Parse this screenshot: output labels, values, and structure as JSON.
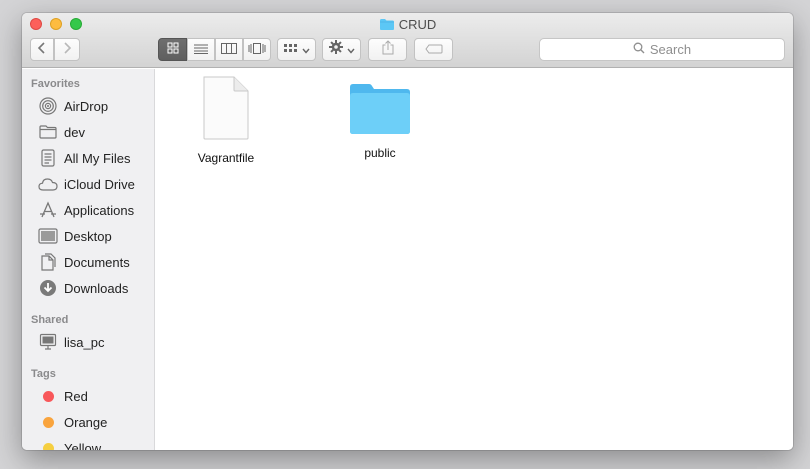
{
  "window": {
    "title": "CRUD"
  },
  "toolbar": {
    "back_icon": "chevron-left-icon",
    "forward_icon": "chevron-right-icon",
    "view_modes": [
      "icon-view",
      "list-view",
      "column-view",
      "cover-flow-view"
    ],
    "active_view": "icon-view",
    "arrange_icon": "arrange-grid-icon",
    "action_icon": "gear-icon",
    "share_icon": "share-icon",
    "tag_icon": "tag-icon",
    "search_placeholder": "Search"
  },
  "sidebar": {
    "favorites": {
      "heading": "Favorites",
      "items": [
        {
          "label": "AirDrop",
          "icon": "airdrop-icon"
        },
        {
          "label": "dev",
          "icon": "folder-icon"
        },
        {
          "label": "All My Files",
          "icon": "all-files-icon"
        },
        {
          "label": "iCloud Drive",
          "icon": "cloud-icon"
        },
        {
          "label": "Applications",
          "icon": "applications-icon"
        },
        {
          "label": "Desktop",
          "icon": "desktop-icon"
        },
        {
          "label": "Documents",
          "icon": "documents-icon"
        },
        {
          "label": "Downloads",
          "icon": "downloads-icon"
        }
      ]
    },
    "shared": {
      "heading": "Shared",
      "items": [
        {
          "label": "lisa_pc",
          "icon": "computer-icon"
        }
      ]
    },
    "tags": {
      "heading": "Tags",
      "items": [
        {
          "label": "Red",
          "color": "#f8575a"
        },
        {
          "label": "Orange",
          "color": "#f9a43d"
        },
        {
          "label": "Yellow",
          "color": "#f5cf41"
        }
      ]
    }
  },
  "files": [
    {
      "name": "Vagrantfile",
      "kind": "document-icon"
    },
    {
      "name": "public",
      "kind": "folder-icon",
      "color": "#5cc7f5"
    }
  ]
}
